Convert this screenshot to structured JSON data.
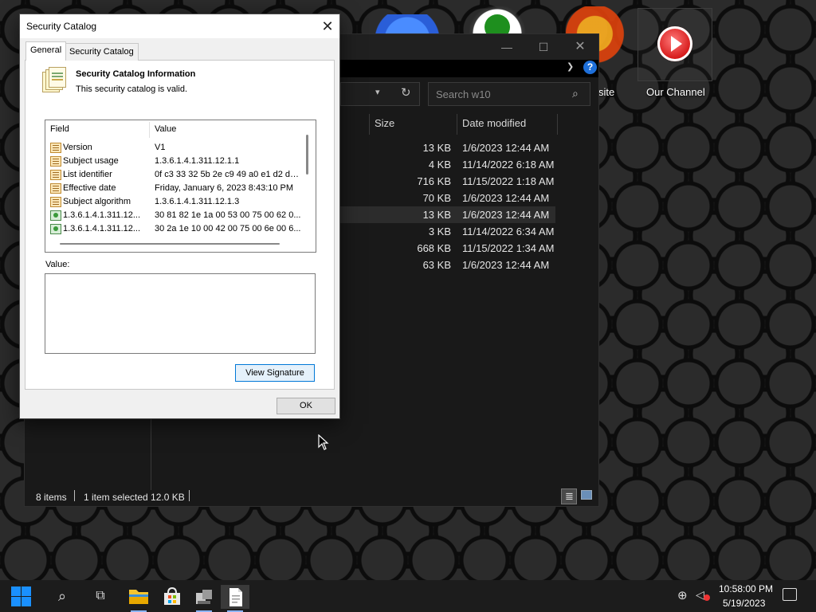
{
  "desktop": {
    "icons": [
      {
        "name": "blue-app-icon",
        "label": ""
      },
      {
        "name": "xbox-icon",
        "label": ""
      },
      {
        "name": "browser-icon",
        "label": "site"
      },
      {
        "name": "channel-play-icon",
        "label": "Our Channel"
      }
    ]
  },
  "explorer": {
    "search_placeholder": "Search w10",
    "columns": {
      "size": "Size",
      "date": "Date modified"
    },
    "rows": [
      {
        "size": "13 KB",
        "date": "1/6/2023 12:44 AM",
        "selected": false
      },
      {
        "size": "4 KB",
        "date": "11/14/2022 6:18 AM",
        "selected": false
      },
      {
        "size": "716 KB",
        "date": "11/15/2022 1:18 AM",
        "selected": false
      },
      {
        "size": "70 KB",
        "date": "1/6/2023 12:44 AM",
        "selected": false
      },
      {
        "size": "13 KB",
        "date": "1/6/2023 12:44 AM",
        "selected": true
      },
      {
        "size": "3 KB",
        "date": "11/14/2022 6:34 AM",
        "selected": false
      },
      {
        "size": "668 KB",
        "date": "11/15/2022 1:34 AM",
        "selected": false
      },
      {
        "size": "63 KB",
        "date": "1/6/2023 12:44 AM",
        "selected": false
      }
    ],
    "status": {
      "count": "8 items",
      "selection": "1 item selected  12.0 KB"
    }
  },
  "dialog": {
    "title": "Security Catalog",
    "tabs": [
      {
        "label": "General",
        "active": true
      },
      {
        "label": "Security Catalog",
        "active": false
      }
    ],
    "info_title": "Security Catalog Information",
    "info_subtitle": "This security catalog is valid.",
    "list_headers": {
      "field": "Field",
      "value": "Value"
    },
    "list_rows": [
      {
        "field": "Version",
        "value": "V1",
        "icon": "property"
      },
      {
        "field": "Subject usage",
        "value": "1.3.6.1.4.1.311.12.1.1",
        "icon": "property"
      },
      {
        "field": "List identifier",
        "value": "0f c3 33 32 5b 2e c9 49 a0 e1 d2 da ...",
        "icon": "property"
      },
      {
        "field": "Effective date",
        "value": "Friday, January 6, 2023 8:43:10 PM",
        "icon": "property"
      },
      {
        "field": "Subject algorithm",
        "value": "1.3.6.1.4.1.311.12.1.3",
        "icon": "property"
      },
      {
        "field": "1.3.6.1.4.1.311.12...",
        "value": "30 81 82 1e 1a 00 53 00 75 00 62 0...",
        "icon": "extension"
      },
      {
        "field": "1.3.6.1.4.1.311.12...",
        "value": "30 2a 1e 10 00 42 00 75 00 6e 00 6...",
        "icon": "extension"
      }
    ],
    "value_label": "Value:",
    "value_text": "",
    "view_signature_label": "View Signature",
    "ok_label": "OK"
  },
  "taskbar": {
    "clock_time": "10:58:00 PM",
    "clock_date": "5/19/2023"
  },
  "colors": {
    "accent": "#0078d7",
    "explorer_bg": "#191919",
    "dialog_bg": "#f0f0f0"
  }
}
